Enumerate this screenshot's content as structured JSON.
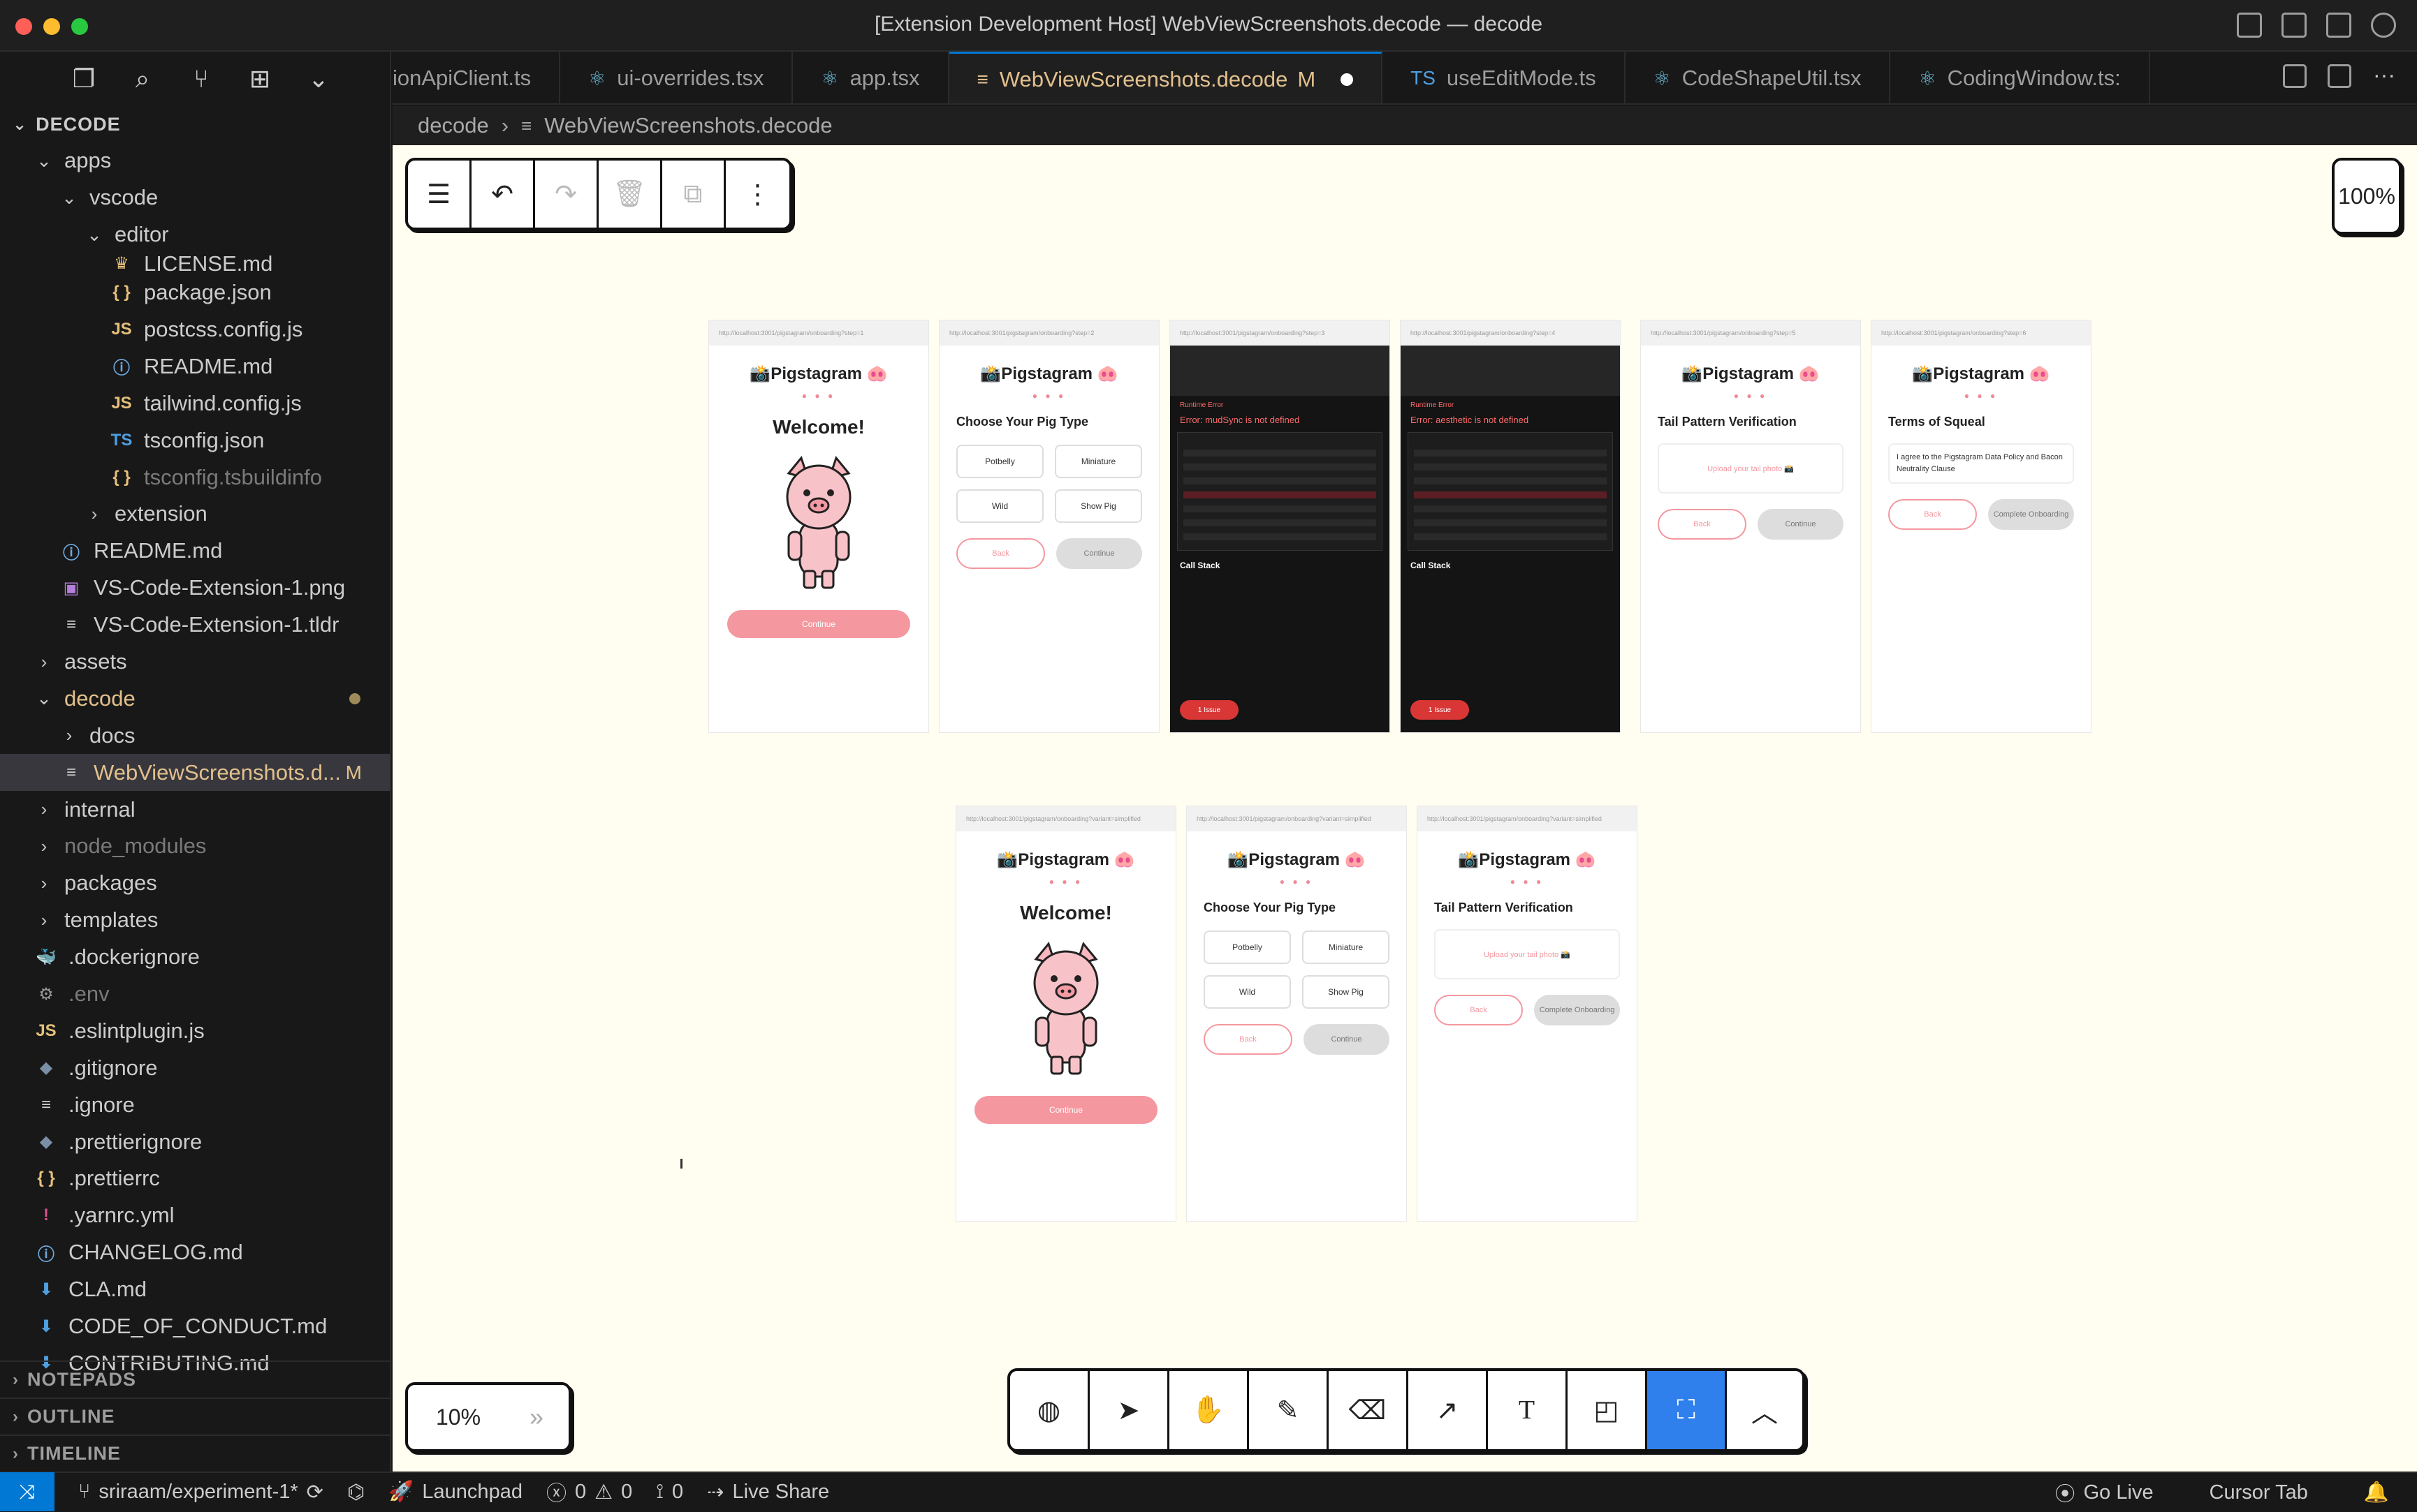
{
  "window": {
    "title": "[Extension Development Host] WebViewScreenshots.decode — decode"
  },
  "sidebar": {
    "section_title": "DECODE",
    "tree": [
      {
        "label": "apps",
        "depth": 0,
        "type": "folder-open"
      },
      {
        "label": "vscode",
        "depth": 1,
        "type": "folder-open"
      },
      {
        "label": "editor",
        "depth": 2,
        "type": "folder-open"
      },
      {
        "label": "LICENSE.md",
        "depth": 3,
        "type": "file",
        "icon": "license-icon"
      },
      {
        "label": "package.json",
        "depth": 3,
        "type": "file",
        "icon": "json-icon"
      },
      {
        "label": "postcss.config.js",
        "depth": 3,
        "type": "file",
        "icon": "js-icon"
      },
      {
        "label": "README.md",
        "depth": 3,
        "type": "file",
        "icon": "info-icon"
      },
      {
        "label": "tailwind.config.js",
        "depth": 3,
        "type": "file",
        "icon": "js-icon"
      },
      {
        "label": "tsconfig.json",
        "depth": 3,
        "type": "file",
        "icon": "ts-icon"
      },
      {
        "label": "tsconfig.tsbuildinfo",
        "depth": 3,
        "type": "file",
        "icon": "json-icon",
        "dim": true
      },
      {
        "label": "extension",
        "depth": 2,
        "type": "folder"
      },
      {
        "label": "README.md",
        "depth": 1,
        "type": "file",
        "icon": "info-icon"
      },
      {
        "label": "VS-Code-Extension-1.png",
        "depth": 1,
        "type": "file",
        "icon": "image-icon"
      },
      {
        "label": "VS-Code-Extension-1.tldr",
        "depth": 1,
        "type": "file",
        "icon": "lines-icon"
      },
      {
        "label": "assets",
        "depth": 0,
        "type": "folder"
      },
      {
        "label": "decode",
        "depth": 0,
        "type": "folder-open",
        "modified": true
      },
      {
        "label": "docs",
        "depth": 1,
        "type": "folder"
      },
      {
        "label": "WebViewScreenshots.d...",
        "depth": 1,
        "type": "file",
        "icon": "lines-icon",
        "active": true,
        "badge": "M"
      },
      {
        "label": "internal",
        "depth": 0,
        "type": "folder"
      },
      {
        "label": "node_modules",
        "depth": 0,
        "type": "folder",
        "dim": true
      },
      {
        "label": "packages",
        "depth": 0,
        "type": "folder"
      },
      {
        "label": "templates",
        "depth": 0,
        "type": "folder"
      },
      {
        "label": ".dockerignore",
        "depth": 0,
        "type": "file",
        "icon": "docker-icon"
      },
      {
        "label": ".env",
        "depth": 0,
        "type": "file",
        "icon": "gear-icon",
        "dim": true
      },
      {
        "label": ".eslintplugin.js",
        "depth": 0,
        "type": "file",
        "icon": "js-icon"
      },
      {
        "label": ".gitignore",
        "depth": 0,
        "type": "file",
        "icon": "git-icon"
      },
      {
        "label": ".ignore",
        "depth": 0,
        "type": "file",
        "icon": "lines-icon"
      },
      {
        "label": ".prettierignore",
        "depth": 0,
        "type": "file",
        "icon": "prettier-icon"
      },
      {
        "label": ".prettierrc",
        "depth": 0,
        "type": "file",
        "icon": "json-icon"
      },
      {
        "label": ".yarnrc.yml",
        "depth": 0,
        "type": "file",
        "icon": "exclaim-icon"
      },
      {
        "label": "CHANGELOG.md",
        "depth": 0,
        "type": "file",
        "icon": "info-icon"
      },
      {
        "label": "CLA.md",
        "depth": 0,
        "type": "file",
        "icon": "download-icon"
      },
      {
        "label": "CODE_OF_CONDUCT.md",
        "depth": 0,
        "type": "file",
        "icon": "download-icon"
      },
      {
        "label": "CONTRIBUTING.md",
        "depth": 0,
        "type": "file",
        "icon": "download-icon"
      }
    ],
    "bottom_sections": [
      "NOTEPADS",
      "OUTLINE",
      "TIMELINE"
    ]
  },
  "tabs": [
    {
      "label": "ionApiClient.ts",
      "icon": ""
    },
    {
      "label": "ui-overrides.tsx",
      "icon": "react-icon"
    },
    {
      "label": "app.tsx",
      "icon": "react-icon"
    },
    {
      "label": "WebViewScreenshots.decode",
      "icon": "lines-icon",
      "active": true,
      "status": "M"
    },
    {
      "label": "useEditMode.ts",
      "icon": "ts-icon"
    },
    {
      "label": "CodeShapeUtil.tsx",
      "icon": "react-icon"
    },
    {
      "label": "CodingWindow.ts:",
      "icon": "react-icon"
    }
  ],
  "breadcrumb": {
    "folder": "decode",
    "file": "WebViewScreenshots.decode"
  },
  "canvas": {
    "zoom_top": "100%",
    "zoom_bottom": "10%",
    "row1": [
      {
        "kind": "welcome",
        "url": "http://localhost:3001/pigstagram/onboarding?step=1",
        "brand": "📸Pigstagram 🐽",
        "heading": "Welcome!",
        "cta": "Continue"
      },
      {
        "kind": "choose",
        "url": "http://localhost:3001/pigstagram/onboarding?step=2",
        "brand": "📸Pigstagram 🐽",
        "heading": "Choose Your Pig Type",
        "options": [
          "Potbelly",
          "Miniature",
          "Wild",
          "Show Pig"
        ],
        "back": "Back",
        "cont": "Continue"
      },
      {
        "kind": "error",
        "url": "http://localhost:3001/pigstagram/onboarding?step=3",
        "title": "Runtime Error",
        "msg": "Error: mudSync is not defined",
        "stack": "Call Stack",
        "badge": "1 Issue"
      },
      {
        "kind": "error",
        "url": "http://localhost:3001/pigstagram/onboarding?step=4",
        "title": "Runtime Error",
        "msg": "Error: aesthetic is not defined",
        "stack": "Call Stack",
        "badge": "1 Issue"
      },
      {
        "kind": "tail",
        "url": "http://localhost:3001/pigstagram/onboarding?step=5",
        "brand": "📸Pigstagram 🐽",
        "heading": "Tail Pattern Verification",
        "upload": "Upload your tail photo 📸",
        "back": "Back",
        "cont": "Continue"
      },
      {
        "kind": "terms",
        "url": "http://localhost:3001/pigstagram/onboarding?step=6",
        "brand": "📸Pigstagram 🐽",
        "heading": "Terms of Squeal",
        "agree": "I agree to the Pigstagram Data Policy and Bacon Neutrality Clause",
        "back": "Back",
        "cont": "Complete Onboarding"
      }
    ],
    "row2": [
      {
        "kind": "welcome",
        "url": "http://localhost:3001/pigstagram/onboarding?variant=simplified",
        "brand": "📸Pigstagram 🐽",
        "heading": "Welcome!",
        "cta": "Continue"
      },
      {
        "kind": "choose",
        "url": "http://localhost:3001/pigstagram/onboarding?variant=simplified",
        "brand": "📸Pigstagram 🐽",
        "heading": "Choose Your Pig Type",
        "options": [
          "Potbelly",
          "Miniature",
          "Wild",
          "Show Pig"
        ],
        "back": "Back",
        "cont": "Continue"
      },
      {
        "kind": "tail",
        "url": "http://localhost:3001/pigstagram/onboarding?variant=simplified",
        "brand": "📸Pigstagram 🐽",
        "heading": "Tail Pattern Verification",
        "upload": "Upload your tail photo 📸",
        "back": "Back",
        "cont": "Complete Onboarding"
      }
    ]
  },
  "statusbar": {
    "branch": "sriraam/experiment-1*",
    "launchpad": "Launchpad",
    "errors": "0",
    "warnings": "0",
    "ports": "0",
    "live_share": "Live Share",
    "go_live": "Go Live",
    "cursor_tab": "Cursor Tab"
  }
}
